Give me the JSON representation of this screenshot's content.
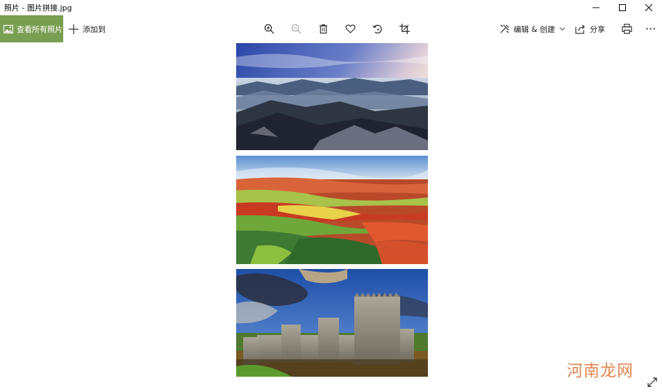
{
  "window": {
    "title": "照片 - 图片拼接.jpg"
  },
  "toolbar": {
    "view_all_label": "查看所有照片",
    "add_to_label": "添加到",
    "edit_create_label": "编辑 & 创建",
    "share_label": "分享"
  },
  "photos": [
    {
      "subject": "mountain landscape with sea of clouds"
    },
    {
      "subject": "red terraced fields"
    },
    {
      "subject": "stone castle with moat"
    }
  ],
  "watermark": "河南龙网",
  "colors": {
    "accent": "#7a9e52",
    "watermark": "#e0854f"
  }
}
